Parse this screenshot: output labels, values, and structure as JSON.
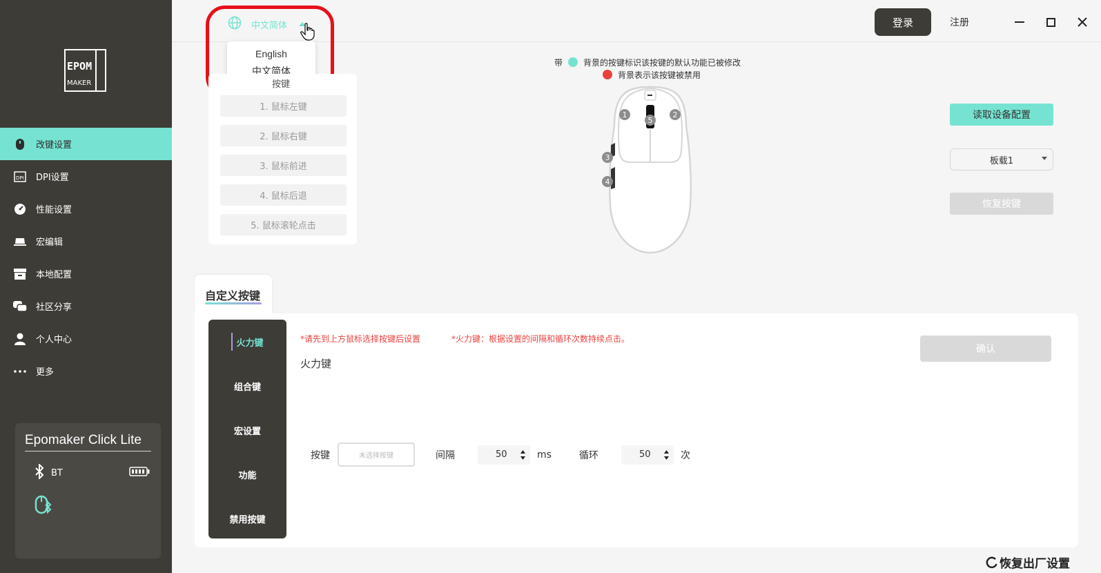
{
  "app": {
    "logo_text": [
      "EPOM",
      "MAKER"
    ]
  },
  "sidebar": {
    "items": [
      {
        "label": "改键设置",
        "icon": "mouse-icon",
        "active": true
      },
      {
        "label": "DPI设置",
        "icon": "dpi-icon"
      },
      {
        "label": "性能设置",
        "icon": "speedometer-icon"
      },
      {
        "label": "宏编辑",
        "icon": "macro-icon"
      },
      {
        "label": "本地配置",
        "icon": "archive-box-icon"
      },
      {
        "label": "社区分享",
        "icon": "chat-bubbles-icon"
      },
      {
        "label": "个人中心",
        "icon": "user-icon"
      },
      {
        "label": "更多",
        "icon": "more-dots-icon"
      }
    ],
    "device": {
      "name": "Epomaker Click Lite",
      "connection": "BT"
    }
  },
  "header": {
    "language": {
      "current": "中文简体",
      "options": [
        "English",
        "中文简体"
      ]
    },
    "login": "登录",
    "register": "注册"
  },
  "keys": {
    "title": "按键",
    "items": [
      "1. 鼠标左键",
      "2. 鼠标右键",
      "3. 鼠标前进",
      "4. 鼠标后退",
      "5. 鼠标滚轮点击"
    ]
  },
  "legend": {
    "modified_prefix": "带",
    "modified_text": "背景的按键标识该按键的默认功能已被修改",
    "disabled_text": "背景表示该按键被禁用",
    "modified_color": "#76e3d2",
    "disabled_color": "#e8423e"
  },
  "mouse_buttons": [
    "1",
    "2",
    "3",
    "4",
    "5"
  ],
  "controls": {
    "read_config": "读取设备配置",
    "board": "板载1",
    "restore_keys": "恢复按键"
  },
  "tab": {
    "label": "自定义按键"
  },
  "subnav": {
    "items": [
      "火力键",
      "组合键",
      "宏设置",
      "功能",
      "禁用按键"
    ],
    "active": "火力键"
  },
  "fire": {
    "hint1": "*请先到上方鼠标选择按键后设置",
    "hint2": "*火力键：根据设置的间隔和循环次数持续点击。",
    "title": "火力键",
    "confirm": "确认",
    "key_label": "按键",
    "key_placeholder": "未选择按键",
    "interval_label": "间隔",
    "interval_value": "50",
    "interval_unit": "ms",
    "loop_label": "循环",
    "loop_value": "50",
    "loop_unit": "次"
  },
  "footer": {
    "factory_reset": "恢复出厂设置"
  },
  "colors": {
    "accent": "#76e3d2",
    "sidebar_bg": "#3d3c37",
    "warning": "#e8423e",
    "highlight_ring": "#e8101a"
  }
}
